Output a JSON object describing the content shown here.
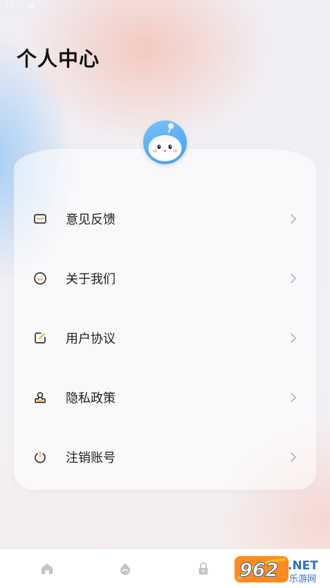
{
  "status_bar": {
    "time": "10:44",
    "carrier_icon": "G"
  },
  "header": {
    "title": "个人中心"
  },
  "menu": {
    "items": [
      {
        "label": "意见反馈",
        "icon": "mail-icon"
      },
      {
        "label": "关于我们",
        "icon": "smile-icon"
      },
      {
        "label": "用户协议",
        "icon": "edit-note-icon"
      },
      {
        "label": "隐私政策",
        "icon": "user-stamp-icon"
      },
      {
        "label": "注销账号",
        "icon": "power-icon"
      }
    ]
  },
  "bottom_nav": {
    "items": [
      {
        "icon": "home-icon"
      },
      {
        "icon": "discover-icon"
      },
      {
        "icon": "lock-icon"
      },
      {
        "icon": "profile-icon"
      }
    ]
  },
  "watermark": {
    "brand": "962",
    "suffix": ".NET",
    "subtitle": "乐游网"
  },
  "colors": {
    "accent": "#f0a83a",
    "icon_stroke": "#333333",
    "chevron": "#a9a9ae",
    "avatar_blue": "#4aa3f2"
  }
}
